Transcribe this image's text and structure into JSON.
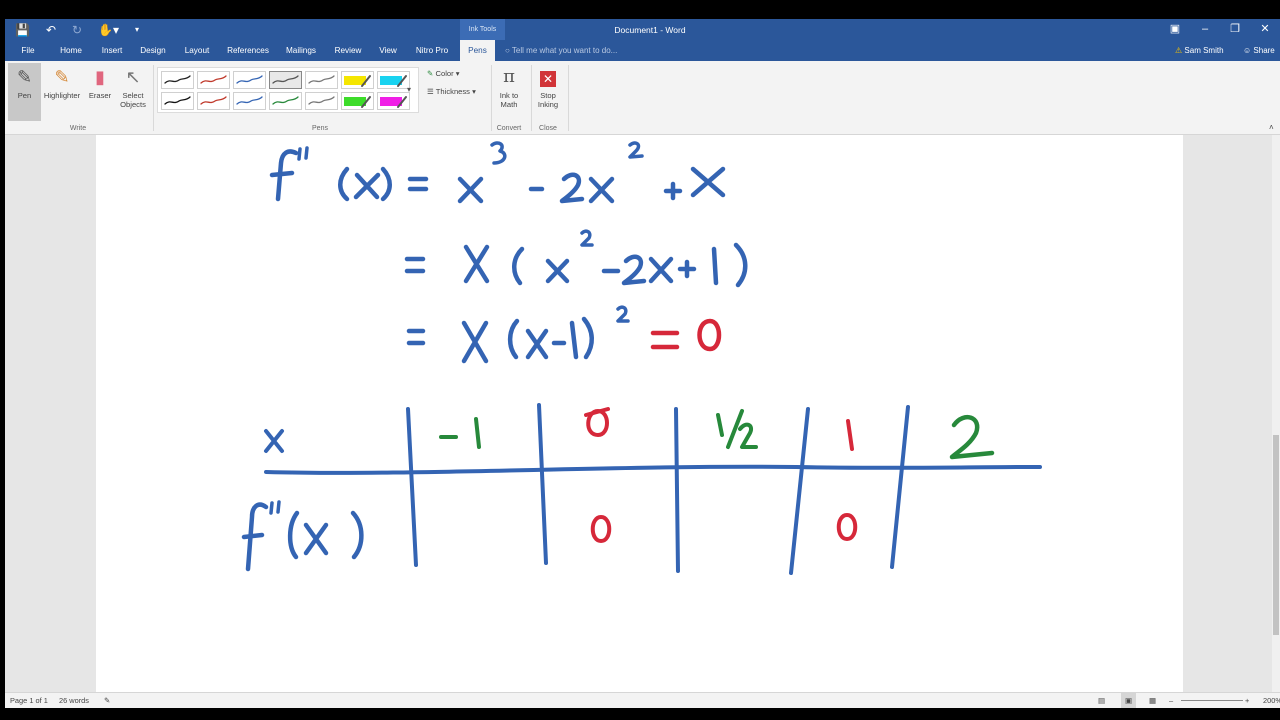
{
  "window": {
    "title": "Document1 - Word",
    "contextual_tab_group": "Ink Tools",
    "qat_icons": [
      "save-icon",
      "undo-icon",
      "redo-icon",
      "touch-mode-icon",
      "customize-icon"
    ]
  },
  "tabs": [
    "File",
    "Home",
    "Insert",
    "Design",
    "Layout",
    "References",
    "Mailings",
    "Review",
    "View",
    "Nitro Pro",
    "Pens"
  ],
  "active_tab": "Pens",
  "tell_me": "Tell me what you want to do...",
  "user": "Sam Smith",
  "share": "Share",
  "ribbon": {
    "write": {
      "label": "Write",
      "pen": "Pen",
      "highlighter": "Highlighter",
      "eraser": "Eraser",
      "select_1": "Select",
      "select_2": "Objects"
    },
    "pens": {
      "label": "Pens",
      "color": "Color",
      "thickness": "Thickness"
    },
    "convert": {
      "label": "Convert",
      "ink_to_math_1": "Ink to",
      "ink_to_math_2": "Math"
    },
    "close": {
      "label": "Close",
      "stop_1": "Stop",
      "stop_2": "Inking"
    }
  },
  "pen_gallery": [
    {
      "color": "#222222",
      "kind": "pen"
    },
    {
      "color": "#c0392b",
      "kind": "pen"
    },
    {
      "color": "#3464b3",
      "kind": "pen"
    },
    {
      "color": "#555555",
      "kind": "pen",
      "selected": true
    },
    {
      "color": "#777777",
      "kind": "pen"
    },
    {
      "color": "#f5e600",
      "kind": "highlighter"
    },
    {
      "color": "#19d3f0",
      "kind": "highlighter"
    },
    {
      "color": "#111111",
      "kind": "pen"
    },
    {
      "color": "#c0392b",
      "kind": "pen"
    },
    {
      "color": "#3464b3",
      "kind": "pen"
    },
    {
      "color": "#27893b",
      "kind": "pen"
    },
    {
      "color": "#777777",
      "kind": "pen"
    },
    {
      "color": "#3ddc2a",
      "kind": "highlighter"
    },
    {
      "color": "#f01fe6",
      "kind": "highlighter"
    }
  ],
  "ink_colors": {
    "blue": "#3464b3",
    "red": "#d6283a",
    "green": "#27893b"
  },
  "status": {
    "page": "Page 1 of 1",
    "words": "26 words",
    "zoom": "200%"
  }
}
